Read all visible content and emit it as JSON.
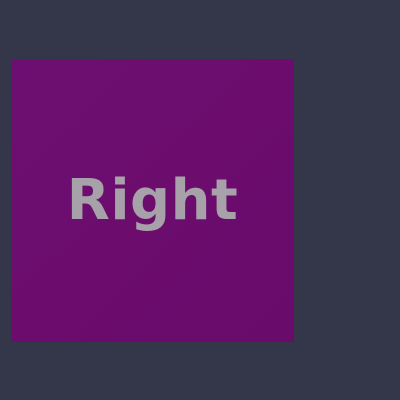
{
  "panel": {
    "label": "Right",
    "background_color": "#6c0d6e",
    "label_color": "#a7a2a9"
  },
  "page": {
    "background_color": "#34364a"
  }
}
